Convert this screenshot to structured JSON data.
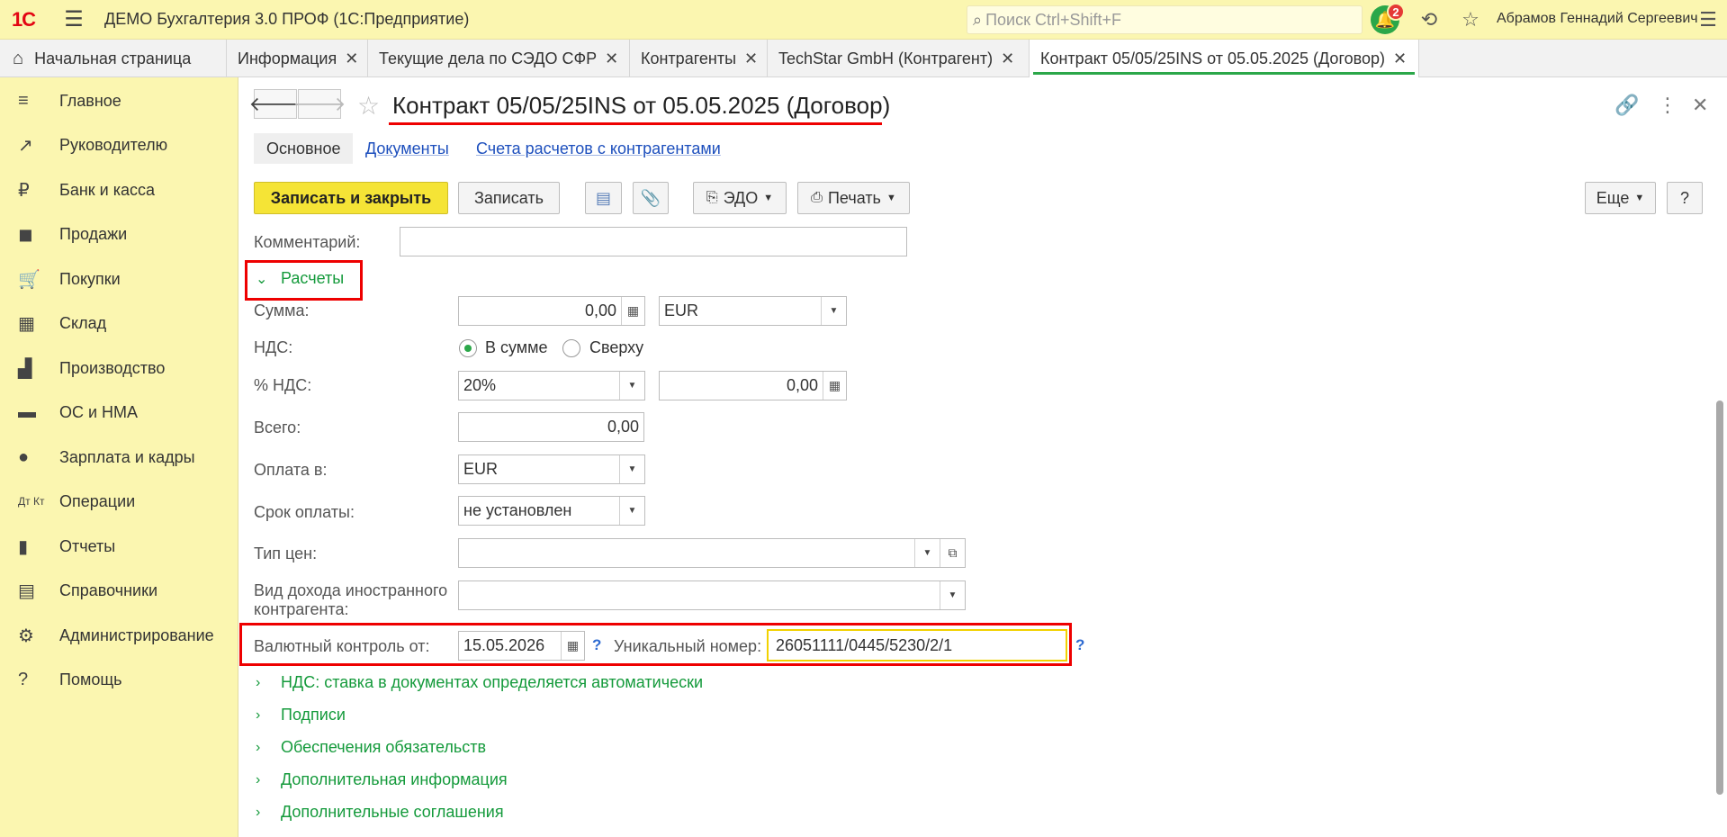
{
  "app": {
    "logo": "1С",
    "title": "ДЕМО Бухгалтерия 3.0 ПРОФ  (1С:Предприятие)",
    "search_placeholder": "Поиск Ctrl+Shift+F",
    "notifications": "2",
    "user": "Абрамов Геннадий Сергеевич"
  },
  "tabs": [
    {
      "label": "Начальная страница"
    },
    {
      "label": "Информация"
    },
    {
      "label": "Текущие дела по СЭДО СФР"
    },
    {
      "label": "Контрагенты"
    },
    {
      "label": "TechStar GmbH (Контрагент)"
    },
    {
      "label": "Контракт 05/05/25INS от 05.05.2025 (Договор)"
    }
  ],
  "sidebar": {
    "items": [
      {
        "label": "Главное",
        "icon": "menu-icon"
      },
      {
        "label": "Руководителю",
        "icon": "trend-icon"
      },
      {
        "label": "Банк и касса",
        "icon": "ruble-icon"
      },
      {
        "label": "Продажи",
        "icon": "bag-icon"
      },
      {
        "label": "Покупки",
        "icon": "cart-icon"
      },
      {
        "label": "Склад",
        "icon": "warehouse-icon"
      },
      {
        "label": "Производство",
        "icon": "factory-icon"
      },
      {
        "label": "ОС и НМА",
        "icon": "truck-icon"
      },
      {
        "label": "Зарплата и кадры",
        "icon": "person-icon"
      },
      {
        "label": "Операции",
        "icon": "dt-kt-icon"
      },
      {
        "label": "Отчеты",
        "icon": "bar-chart-icon"
      },
      {
        "label": "Справочники",
        "icon": "book-icon"
      },
      {
        "label": "Администрирование",
        "icon": "gear-icon"
      },
      {
        "label": "Помощь",
        "icon": "help-icon"
      }
    ]
  },
  "document": {
    "title": "Контракт 05/05/25INS от 05.05.2025 (Договор)",
    "subtabs": {
      "main": "Основное",
      "documents": "Документы",
      "accounts": "Счета расчетов с контрагентами"
    },
    "toolbar": {
      "save_close": "Записать и закрыть",
      "save": "Записать",
      "edo": "ЭДО",
      "print": "Печать",
      "more": "Еще",
      "help": "?"
    },
    "comment": {
      "label": "Комментарий:",
      "value": ""
    },
    "calc_group": "Расчеты",
    "sum": {
      "label": "Сумма:",
      "value": "0,00",
      "currency": "EUR"
    },
    "vat": {
      "label": "НДС:",
      "opt_in_sum": "В сумме",
      "opt_above": "Сверху",
      "selected": "В сумме"
    },
    "vat_rate": {
      "label": "% НДС:",
      "value": "20%",
      "amount": "0,00"
    },
    "total": {
      "label": "Всего:",
      "value": "0,00"
    },
    "pay_in": {
      "label": "Оплата в:",
      "value": "EUR"
    },
    "pay_term": {
      "label": "Срок оплаты:",
      "value": "не установлен"
    },
    "price_type": {
      "label": "Тип цен:",
      "value": ""
    },
    "foreign_income": {
      "label_line1": "Вид дохода иностранного",
      "label_line2": "контрагента:",
      "value": ""
    },
    "currency_control": {
      "label": "Валютный контроль от:",
      "date": "15.05.2026",
      "q": "?",
      "unique_label": "Уникальный номер:",
      "unique_value": "26051111/0445/5230/2/1"
    },
    "groups": [
      "НДС: ставка в документах определяется автоматически",
      "Подписи",
      "Обеспечения обязательств",
      "Дополнительная информация",
      "Дополнительные соглашения"
    ]
  }
}
